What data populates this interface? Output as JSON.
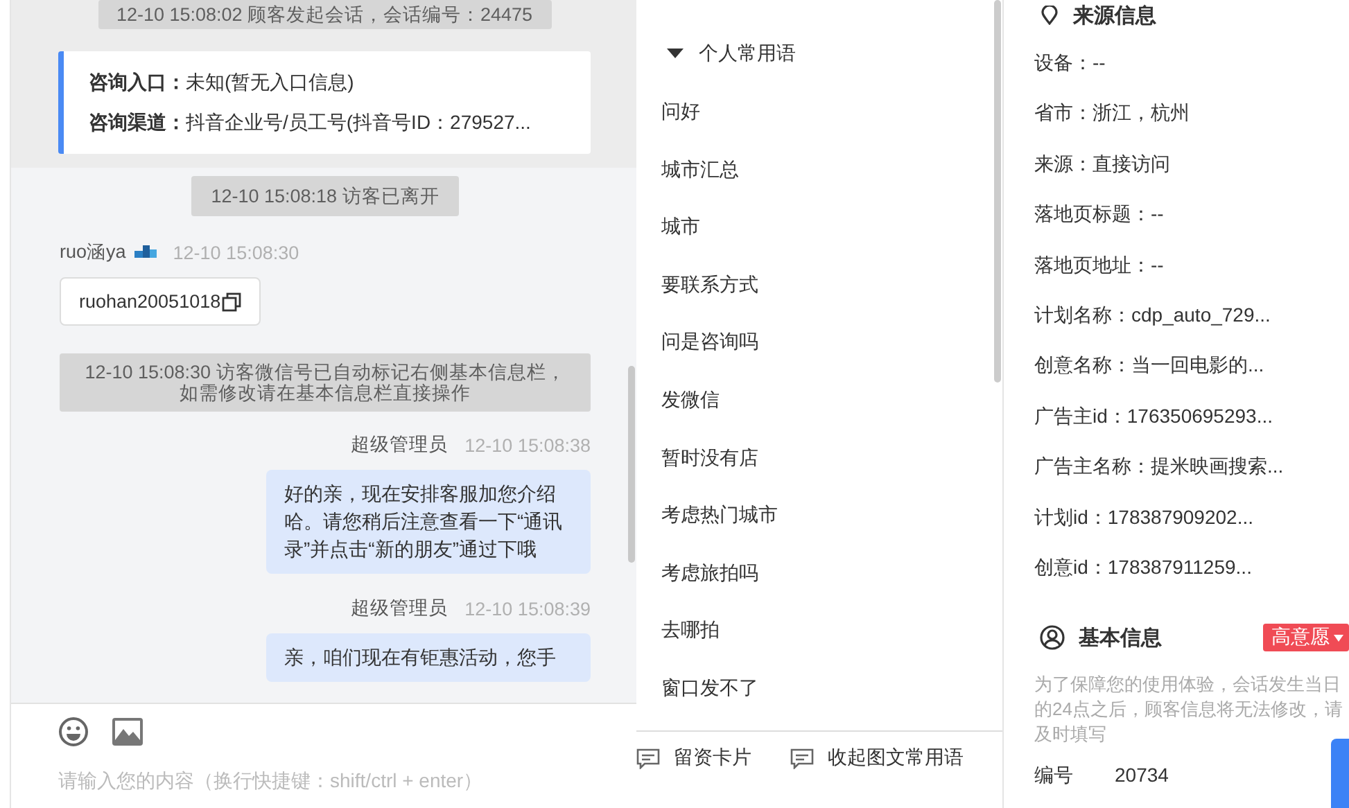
{
  "chat": {
    "header_notice": "12-10 15:08:02 顾客发起会话，会话编号：24475",
    "entry_card": [
      {
        "label": "咨询入口：",
        "value": "未知(暂无入口信息)"
      },
      {
        "label": "咨询渠道：",
        "value": "抖音企业号/员工号(抖音号ID：279527..."
      }
    ],
    "messages": [
      {
        "kind": "notice",
        "text": "12-10 15:08:18 访客已离开"
      },
      {
        "kind": "visitor",
        "name": "ruo涵ya",
        "time": "12-10 15:08:30",
        "card": "ruohan20051018"
      },
      {
        "kind": "notice",
        "text": "12-10 15:08:30 访客微信号已自动标记右侧基本信息栏，如需修改请在基本信息栏直接操作"
      },
      {
        "kind": "agent",
        "name": "超级管理员",
        "time": "12-10 15:08:38",
        "text": "好的亲，现在安排客服加您介绍哈。请您稍后注意查看一下“通讯录”并点击“新的朋友”通过下哦"
      },
      {
        "kind": "agent",
        "name": "超级管理员",
        "time": "12-10 15:08:39",
        "text": "亲，咱们现在有钜惠活动，您手"
      }
    ],
    "composer": {
      "placeholder": "请输入您的内容（换行快捷键：shift/ctrl + enter）"
    }
  },
  "phrases": {
    "group": {
      "label": "个人常用语",
      "expanded": true
    },
    "items": [
      "问好",
      "城市汇总",
      "城市",
      "要联系方式",
      "问是咨询吗",
      "发微信",
      "暂时没有店",
      "考虑热门城市",
      "考虑旅拍吗",
      "去哪拍",
      "窗口发不了"
    ],
    "actions": [
      "留资卡片",
      "收起图文常用语"
    ]
  },
  "info": {
    "source_title": "来源信息",
    "source_lines": [
      "设备：--",
      "省市：浙江，杭州",
      "来源：直接访问",
      "落地页标题：--",
      "落地页地址：--",
      "计划名称：cdp_auto_729...",
      "创意名称：当一回电影的...",
      "广告主id：176350695293...",
      "广告主名称：提米映画搜索...",
      "计划id：178387909202...",
      "创意id：178387911259..."
    ],
    "basic_title": "基本信息",
    "intent_tag": "高意愿",
    "note": "为了保障您的使用体验，会话发生当日的24点之后，顾客信息将无法修改，请及时填写",
    "basic_fields": [
      {
        "label": "编号",
        "value": "20734"
      }
    ]
  }
}
